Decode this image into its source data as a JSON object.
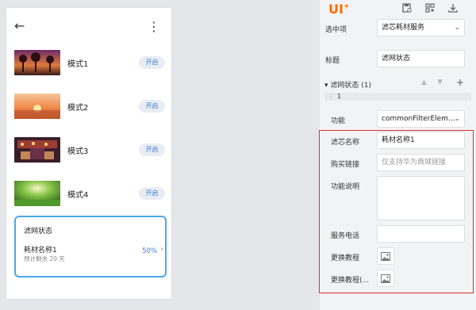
{
  "phone": {
    "modes": [
      {
        "label": "模式1",
        "button": "开启"
      },
      {
        "label": "模式2",
        "button": "开启"
      },
      {
        "label": "模式3",
        "button": "开启"
      },
      {
        "label": "模式4",
        "button": "开启"
      }
    ],
    "filter_card": {
      "title": "滤网状态",
      "name": "耗材名称1",
      "remaining": "预计剩余 20 天",
      "percent": "50%"
    }
  },
  "panel": {
    "logo": "UI",
    "selected_label": "选中项",
    "selected_value": "滤芯耗材服务",
    "title_label": "标题",
    "title_value": "滤网状态",
    "section_title": "滤网状态 (1)",
    "sub_index": "1",
    "function_label": "功能",
    "function_value": "commonFilterElem...",
    "filter_name_label": "滤芯名称",
    "filter_name_value": "耗材名称1",
    "buy_link_label": "购买链接",
    "buy_link_placeholder": "仅支持华为商城链接",
    "desc_label": "功能说明",
    "phone_label": "服务电话",
    "tutorial_label": "更换教程",
    "tutorial2_label": "更换教程(..."
  },
  "colors": {
    "accent": "#3d7fd8",
    "highlight": "#d9332c",
    "card_border": "#4aa9e9",
    "logo": "#ff6a00"
  }
}
